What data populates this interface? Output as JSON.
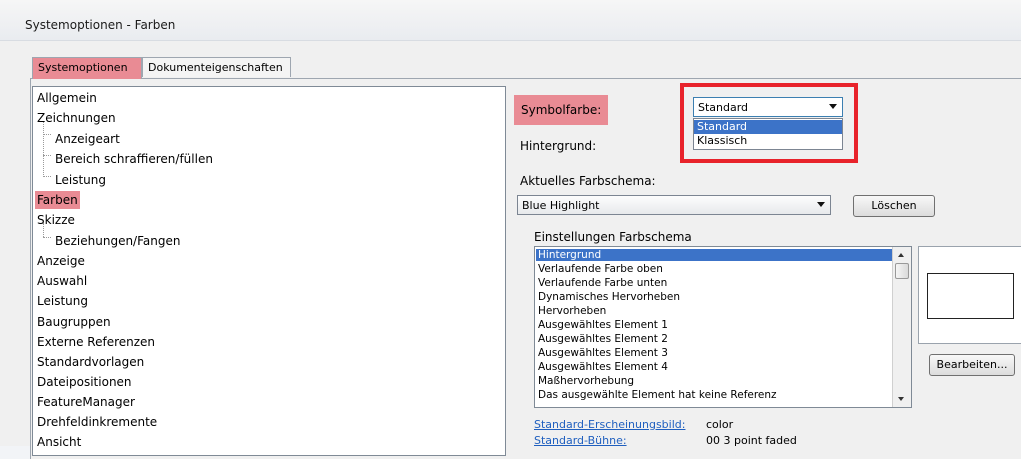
{
  "window": {
    "title": "Systemoptionen - Farben"
  },
  "tabs": [
    {
      "label": "Systemoptionen"
    },
    {
      "label": "Dokumenteigenschaften"
    }
  ],
  "tree": [
    {
      "label": "Allgemein"
    },
    {
      "label": "Zeichnungen"
    },
    {
      "label": "Anzeigeart"
    },
    {
      "label": "Bereich schraffieren/füllen"
    },
    {
      "label": "Leistung"
    },
    {
      "label": "Farben"
    },
    {
      "label": "Skizze"
    },
    {
      "label": "Beziehungen/Fangen"
    },
    {
      "label": "Anzeige"
    },
    {
      "label": "Auswahl"
    },
    {
      "label": "Leistung"
    },
    {
      "label": "Baugruppen"
    },
    {
      "label": "Externe Referenzen"
    },
    {
      "label": "Standardvorlagen"
    },
    {
      "label": "Dateipositionen"
    },
    {
      "label": "FeatureManager"
    },
    {
      "label": "Drehfeldinkremente"
    },
    {
      "label": "Ansicht"
    }
  ],
  "symbol_color": {
    "label": "Symbolfarbe:",
    "value": "Standard",
    "options": [
      "Standard",
      "Klassisch"
    ]
  },
  "background": {
    "label": "Hintergrund:"
  },
  "scheme": {
    "label": "Aktuelles Farbschema:",
    "value": "Blue Highlight",
    "delete_button": "Löschen"
  },
  "scheme_settings": {
    "label": "Einstellungen Farbschema",
    "items": [
      "Hintergrund",
      "Verlaufende Farbe oben",
      "Verlaufende Farbe unten",
      "Dynamisches Hervorheben",
      "Hervorheben",
      "Ausgewähltes Element 1",
      "Ausgewähltes Element 2",
      "Ausgewähltes Element 3",
      "Ausgewähltes Element 4",
      "Maßhervorhebung",
      "Das ausgewählte Element hat keine Referenz"
    ],
    "edit_button": "Bearbeiten..."
  },
  "footer": {
    "appearance_label": "Standard-Erscheinungsbild:",
    "appearance_value": "color",
    "stage_label": "Standard-Bühne:",
    "stage_value": "00 3 point faded"
  },
  "colors": {
    "highlight": "#e98b94",
    "callout_border": "#e8232b",
    "selection": "#3c73c8"
  }
}
